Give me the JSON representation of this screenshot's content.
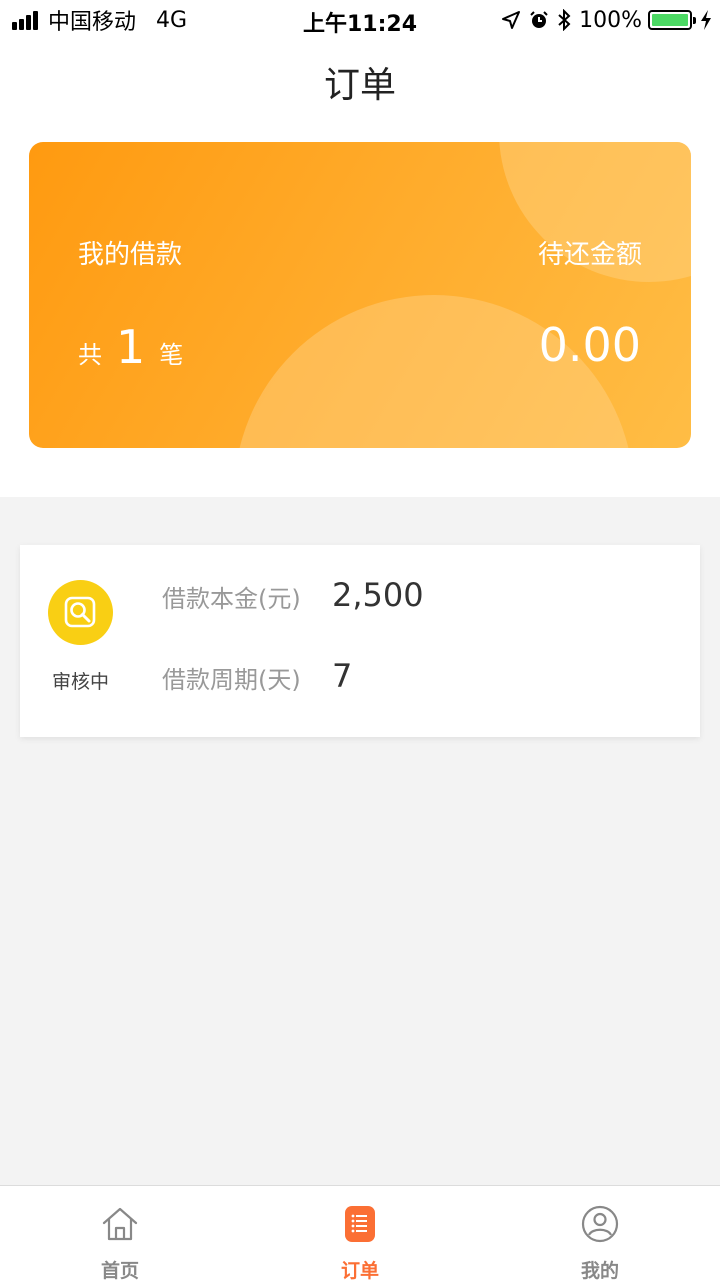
{
  "status_bar": {
    "carrier": "中国移动",
    "network": "4G",
    "time": "上午11:24",
    "battery": "100%"
  },
  "header": {
    "title": "订单"
  },
  "summary": {
    "my_loans_label": "我的借款",
    "pending_label": "待还金额",
    "count_prefix": "共",
    "count": "1",
    "count_suffix": "笔",
    "amount": "0.00"
  },
  "order": {
    "status": "审核中",
    "principal_label": "借款本金(元)",
    "principal_value": "2,500",
    "period_label": "借款周期(天)",
    "period_value": "7"
  },
  "tabs": [
    {
      "label": "首页",
      "icon": "home-icon",
      "active": false
    },
    {
      "label": "订单",
      "icon": "order-list-icon",
      "active": true
    },
    {
      "label": "我的",
      "icon": "user-icon",
      "active": false
    }
  ],
  "colors": {
    "accent": "#fb6f34",
    "card_gradient_start": "#ff9a10",
    "card_gradient_end": "#ffbd45",
    "status_icon": "#f9cf14",
    "battery": "#4cd964"
  }
}
